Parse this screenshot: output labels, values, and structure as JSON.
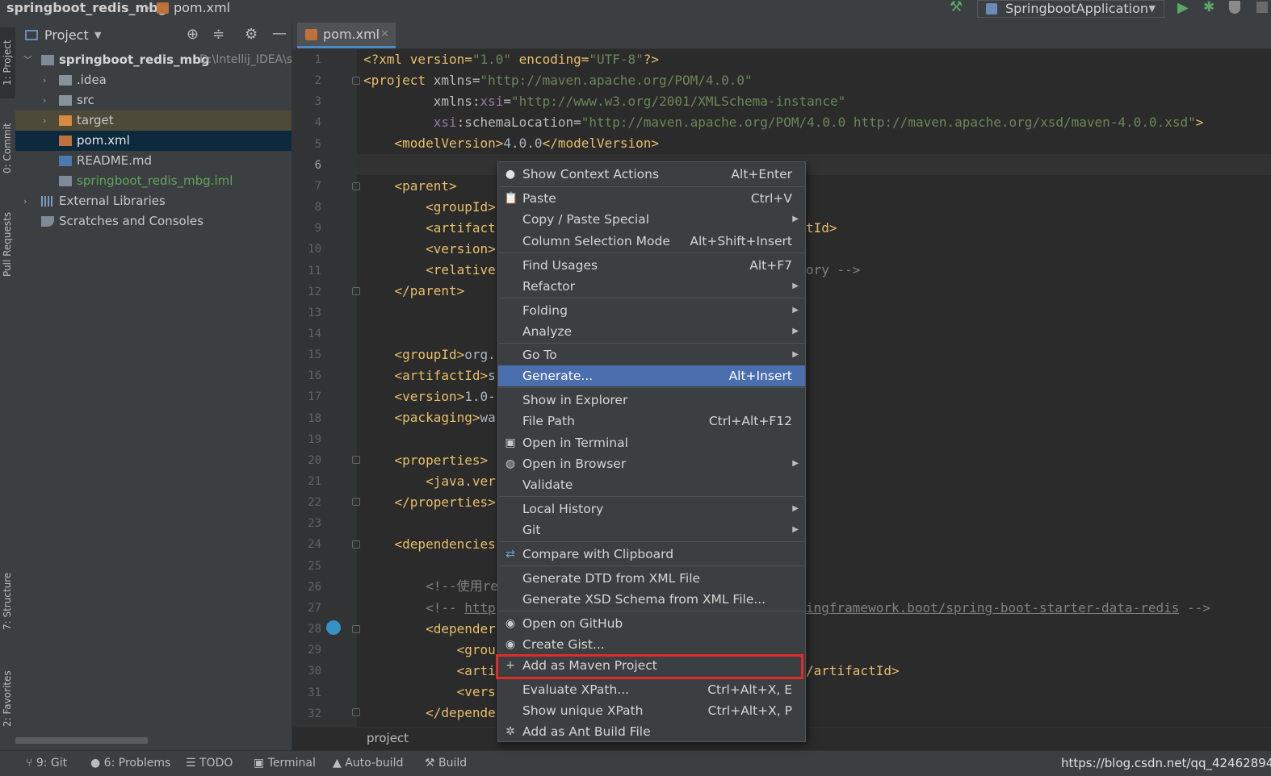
{
  "titlebar": {
    "project_name": "springboot_redis_mbg",
    "file_name": "pom.xml",
    "run_config": "SpringbootApplication"
  },
  "left_strip": {
    "project": "1: Project",
    "commit": "0: Commit",
    "pull_requests": "Pull Requests",
    "structure": "7: Structure",
    "favorites": "2: Favorites"
  },
  "project_panel": {
    "title": "Project",
    "tree": [
      {
        "label": "springboot_redis_mbg",
        "path": "D:\\Intellij_IDEA\\s"
      },
      {
        "label": ".idea"
      },
      {
        "label": "src"
      },
      {
        "label": "target"
      },
      {
        "label": "pom.xml"
      },
      {
        "label": "README.md"
      },
      {
        "label": "springboot_redis_mbg.iml"
      },
      {
        "label": "External Libraries"
      },
      {
        "label": "Scratches and Consoles"
      }
    ]
  },
  "editor": {
    "tab": "pom.xml",
    "line_numbers": [
      "1",
      "2",
      "3",
      "4",
      "5",
      "6",
      "7",
      "8",
      "9",
      "10",
      "11",
      "12",
      "13",
      "14",
      "15",
      "16",
      "17",
      "18",
      "19",
      "20",
      "21",
      "22",
      "23",
      "24",
      "25",
      "26",
      "27",
      "28",
      "29",
      "30",
      "31",
      "32"
    ],
    "code": {
      "l1_a": "<?xml version=",
      "l1_b": "\"1.0\"",
      "l1_c": " encoding=",
      "l1_d": "\"UTF-8\"",
      "l1_e": "?>",
      "l2_a": "<project ",
      "l2_b": "xmlns=",
      "l2_c": "\"http://maven.apache.org/POM/4.0.0\"",
      "l3_a": "         xmlns:",
      "l3_b": "xsi",
      "l3_c": "=",
      "l3_d": "\"http://www.w3.org/2001/XMLSchema-instance\"",
      "l4_a": "         ",
      "l4_b": "xsi",
      "l4_c": ":schemaLocation=",
      "l4_d": "\"http://maven.apache.org/POM/4.0.0 http://maven.apache.org/xsd/maven-4.0.0.xsd\"",
      "l4_e": ">",
      "l5_a": "    <modelVersion>",
      "l5_b": "4.0.0",
      "l5_c": "</modelVersion>",
      "l7": "    <parent>",
      "l8": "        <groupId>",
      "l9": "        <artifact",
      "l9_tail": "tId>",
      "l10": "        <version>",
      "l11": "        <relative",
      "l11_tail": "ory -->",
      "l12": "    </parent>",
      "l15_a": "    <groupId>",
      "l15_b": "org.",
      "l16_a": "    <artifactId>",
      "l16_b": "s",
      "l17_a": "    <version>",
      "l17_b": "1.0-",
      "l18_a": "    <packaging>",
      "l18_b": "wa",
      "l20": "    <properties>",
      "l21": "        <java.ver",
      "l22": "    </properties>",
      "l24": "    <dependencies",
      "l26": "        <!--使用re",
      "l27_a": "        <!-- ",
      "l27_b": "http",
      "l27_tail": "ingframework.boot/spring-boot-starter-data-redis",
      "l27_end": " -->",
      "l28": "        <depender",
      "l29": "            <grou",
      "l30": "            <arti",
      "l30_tail": "/artifactId>",
      "l31": "            <vers",
      "l32": "        </depende"
    },
    "breadcrumb": "project"
  },
  "context_menu": {
    "items": [
      {
        "label": "Show Context Actions",
        "shortcut": "Alt+Enter"
      },
      {
        "label": "Paste",
        "shortcut": "Ctrl+V"
      },
      {
        "label": "Copy / Paste Special",
        "shortcut": ""
      },
      {
        "label": "Column Selection Mode",
        "shortcut": "Alt+Shift+Insert"
      },
      {
        "label": "Find Usages",
        "shortcut": "Alt+F7"
      },
      {
        "label": "Refactor",
        "shortcut": ""
      },
      {
        "label": "Folding",
        "shortcut": ""
      },
      {
        "label": "Analyze",
        "shortcut": ""
      },
      {
        "label": "Go To",
        "shortcut": ""
      },
      {
        "label": "Generate...",
        "shortcut": "Alt+Insert"
      },
      {
        "label": "Show in Explorer",
        "shortcut": ""
      },
      {
        "label": "File Path",
        "shortcut": "Ctrl+Alt+F12"
      },
      {
        "label": "Open in Terminal",
        "shortcut": ""
      },
      {
        "label": "Open in Browser",
        "shortcut": ""
      },
      {
        "label": "Validate",
        "shortcut": ""
      },
      {
        "label": "Local History",
        "shortcut": ""
      },
      {
        "label": "Git",
        "shortcut": ""
      },
      {
        "label": "Compare with Clipboard",
        "shortcut": ""
      },
      {
        "label": "Generate DTD from XML File",
        "shortcut": ""
      },
      {
        "label": "Generate XSD Schema from XML File...",
        "shortcut": ""
      },
      {
        "label": "Open on GitHub",
        "shortcut": ""
      },
      {
        "label": "Create Gist...",
        "shortcut": ""
      },
      {
        "label": "Add as Maven Project",
        "shortcut": ""
      },
      {
        "label": "Evaluate XPath...",
        "shortcut": "Ctrl+Alt+X, E"
      },
      {
        "label": "Show unique XPath",
        "shortcut": "Ctrl+Alt+X, P"
      },
      {
        "label": "Add as Ant Build File",
        "shortcut": ""
      }
    ]
  },
  "statusbar": {
    "git": "9: Git",
    "problems": "6: Problems",
    "todo": "TODO",
    "terminal": "Terminal",
    "autobuild": "Auto-build",
    "build": "Build",
    "watermark": "https://blog.csdn.net/qq_42462894"
  },
  "colors": {
    "highlight": "#4b6eaf",
    "annotation_box": "#e02b2b",
    "xml_tag": "#e8bf6a",
    "xml_string": "#6a8759"
  }
}
